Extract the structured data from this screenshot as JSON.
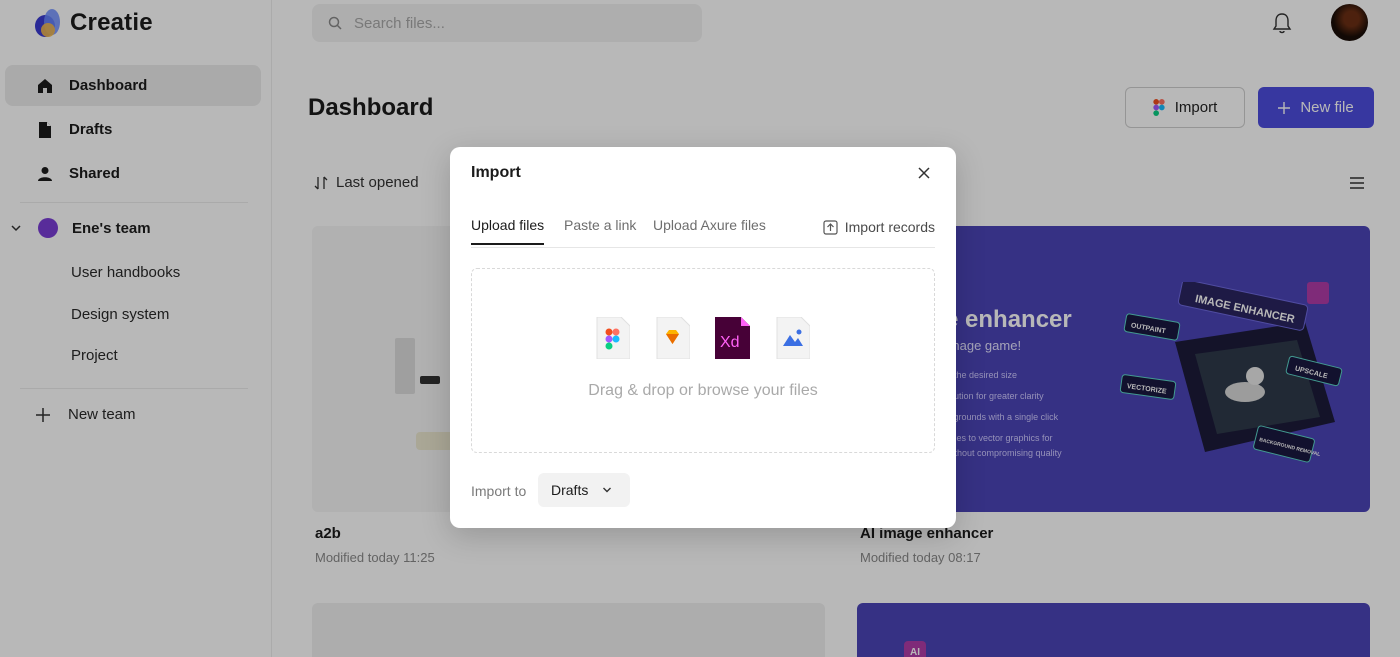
{
  "app": {
    "brand": "Creatie"
  },
  "sidebar": {
    "items": [
      {
        "label": "Dashboard",
        "icon": "home-icon"
      },
      {
        "label": "Drafts",
        "icon": "file-icon"
      },
      {
        "label": "Shared",
        "icon": "user-icon"
      }
    ],
    "team": {
      "name": "Ene's team",
      "color": "#7a3ed6"
    },
    "team_items": [
      "User handbooks",
      "Design system",
      "Project"
    ],
    "new_team": "New team"
  },
  "topbar": {
    "search_placeholder": "Search files..."
  },
  "main": {
    "title": "Dashboard",
    "import_label": "Import",
    "new_file_label": "New file",
    "sort_label": "Last opened",
    "accent": "#4d4dde",
    "cards": [
      {
        "name": "a2b",
        "meta": "Modified today 11:25"
      },
      {
        "name": "AI image enhancer",
        "meta": "Modified today 08:17",
        "thumb_title": "age enhancer",
        "thumb_sub": "your image game!",
        "thumb_lines": [
          "image to the desired size",
          "age resolution for greater clarity",
          "age backgrounds with a single click",
          "map images to vector graphics for",
          "editing without compromising quality"
        ],
        "badges": [
          "IMAGE ENHANCER",
          "OUTPAINT",
          "UPSCALE",
          "VECTORIZE",
          "BACKGROUND REMOVAL"
        ]
      }
    ],
    "partial_badge": "AI"
  },
  "modal": {
    "title": "Import",
    "tabs": [
      "Upload files",
      "Paste a link",
      "Upload Axure files"
    ],
    "import_records": "Import records",
    "dropzone_text": "Drag & drop or browse your files",
    "file_types": [
      "figma-file-icon",
      "sketch-file-icon",
      "xd-file-icon",
      "image-file-icon"
    ],
    "xd_label": "Xd",
    "import_to_label": "Import to",
    "import_to_value": "Drafts"
  }
}
